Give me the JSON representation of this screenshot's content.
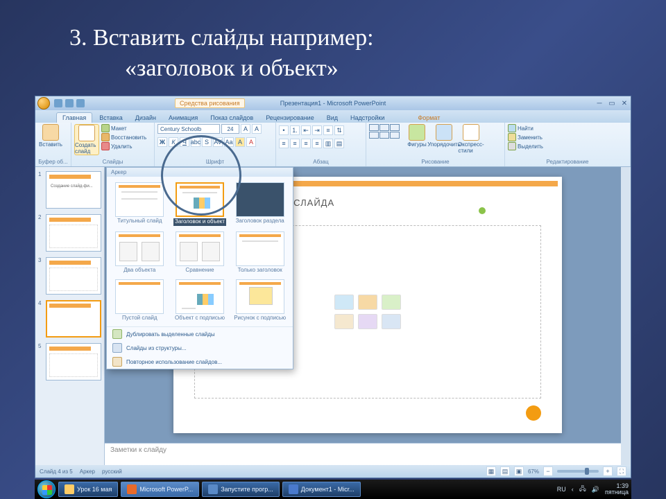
{
  "outer": {
    "line1": "3. Вставить слайды например:",
    "line2": "«заголовок и объект»"
  },
  "titlebar": {
    "doc": "Презентация1 - Microsoft PowerPoint",
    "contextual": "Средства рисования"
  },
  "tabs": {
    "home": "Главная",
    "insert": "Вставка",
    "design": "Дизайн",
    "anim": "Анимация",
    "show": "Показ слайдов",
    "review": "Рецензирование",
    "view": "Вид",
    "addins": "Надстройки",
    "format": "Формат"
  },
  "ribbon": {
    "clipboard": {
      "label": "Буфер об...",
      "paste": "Вставить"
    },
    "slides": {
      "label": "Слайды",
      "new": "Создать слайд",
      "layout": "Макет",
      "reset": "Восстановить",
      "delete": "Удалить"
    },
    "font": {
      "label": "Шрифт",
      "name": "Century Schoolb",
      "size": "24"
    },
    "para": {
      "label": "Абзац"
    },
    "drawing": {
      "label": "Рисование",
      "shapes": "Фигуры",
      "arrange": "Упорядочить",
      "styles": "Экспресс-стили"
    },
    "editing": {
      "label": "Редактирование",
      "find": "Найти",
      "replace": "Заменить",
      "select": "Выделить"
    }
  },
  "gallery": {
    "header": "Аркер",
    "items": [
      "Титульный слайд",
      "Заголовок и объект",
      "Заголовок раздела",
      "Два объекта",
      "Сравнение",
      "Только заголовок",
      "Пустой слайд",
      "Объект с подписью",
      "Рисунок с подписью"
    ],
    "footer": {
      "dup": "Дублировать выделенные слайды",
      "outline": "Слайды из структуры...",
      "reuse": "Повторное использование слайдов..."
    }
  },
  "thumbs": {
    "t1": "Создание слайд-фи..."
  },
  "slide": {
    "title_placeholder": "К СЛАЙДА"
  },
  "notes": "Заметки к слайду",
  "statusbar": {
    "slide": "Слайд 4 из 5",
    "theme": "Аркер",
    "lang": "русский",
    "zoom": "67%"
  },
  "taskbar": {
    "t1": "Урок 16 мая",
    "t2": "Microsoft PowerP...",
    "t3": "Запустите прогр...",
    "t4": "Документ1 - Micr...",
    "lang": "RU",
    "time": "1:39",
    "day": "пятница"
  }
}
